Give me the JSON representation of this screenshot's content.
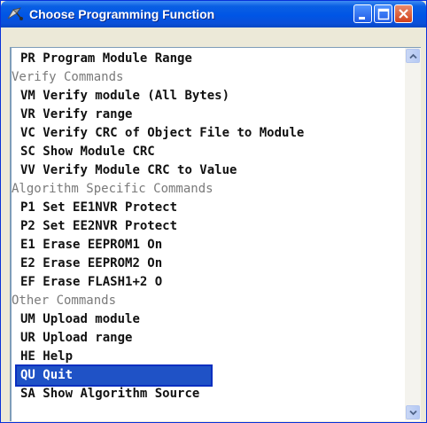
{
  "window": {
    "title": "Choose Programming Function"
  },
  "icons": {
    "app": "satellite-app-icon",
    "minimize": "minimize-icon",
    "maximize": "maximize-icon",
    "close": "close-icon"
  },
  "colors": {
    "titlebar": "#0055e5",
    "selection": "#1f52c6",
    "category_text": "#7a7a7a"
  },
  "list": {
    "selected_index": 17,
    "items": [
      {
        "kind": "cmd",
        "code": "PR",
        "label": "Program Module Range"
      },
      {
        "kind": "cat",
        "label": "Verify Commands"
      },
      {
        "kind": "cmd",
        "code": "VM",
        "label": "Verify module (All Bytes)"
      },
      {
        "kind": "cmd",
        "code": "VR",
        "label": "Verify range"
      },
      {
        "kind": "cmd",
        "code": "VC",
        "label": "Verify CRC of Object File to Module"
      },
      {
        "kind": "cmd",
        "code": "SC",
        "label": "Show Module CRC"
      },
      {
        "kind": "cmd",
        "code": "VV",
        "label": "Verify Module CRC to Value"
      },
      {
        "kind": "cat",
        "label": "Algorithm Specific Commands"
      },
      {
        "kind": "cmd",
        "code": "P1",
        "label": "Set EE1NVR Protect"
      },
      {
        "kind": "cmd",
        "code": "P2",
        "label": "Set EE2NVR Protect"
      },
      {
        "kind": "cmd",
        "code": "E1",
        "label": "Erase EEPROM1 On"
      },
      {
        "kind": "cmd",
        "code": "E2",
        "label": "Erase EEPROM2 On"
      },
      {
        "kind": "cmd",
        "code": "EF",
        "label": "Erase FLASH1+2 O"
      },
      {
        "kind": "cat",
        "label": "Other Commands"
      },
      {
        "kind": "cmd",
        "code": "UM",
        "label": "Upload module"
      },
      {
        "kind": "cmd",
        "code": "UR",
        "label": "Upload range"
      },
      {
        "kind": "cmd",
        "code": "HE",
        "label": "Help"
      },
      {
        "kind": "cmd",
        "code": "QU",
        "label": "Quit"
      },
      {
        "kind": "cmd",
        "code": "SA",
        "label": "Show Algorithm Source"
      }
    ]
  }
}
